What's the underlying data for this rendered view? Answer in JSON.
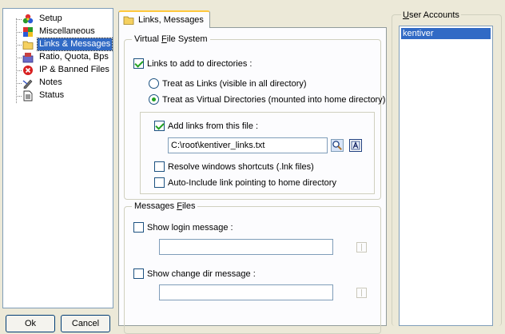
{
  "tree": {
    "items": [
      {
        "label": "Setup",
        "icon": "setup-icon"
      },
      {
        "label": "Miscellaneous",
        "icon": "miscellaneous-icon"
      },
      {
        "label": "Links & Messages",
        "icon": "folder-icon",
        "selected": true
      },
      {
        "label": "Ratio, Quota, Bps",
        "icon": "ratio-icon"
      },
      {
        "label": "IP & Banned Files",
        "icon": "banned-icon"
      },
      {
        "label": "Notes",
        "icon": "notes-icon"
      },
      {
        "label": "Status",
        "icon": "status-icon"
      }
    ]
  },
  "buttons": {
    "ok": "Ok",
    "cancel": "Cancel"
  },
  "tab": {
    "label": "Links, Messages"
  },
  "vfs": {
    "title_prefix": "Virtual ",
    "title_mnemonic": "F",
    "title_suffix": "ile System",
    "links_to_add": {
      "label": "Links to add to directories :",
      "checked": true
    },
    "treat_links": {
      "label": "Treat as Links (visible in all directory)",
      "checked": false
    },
    "treat_virtual": {
      "label": "Treat as Virtual Directories (mounted into home directory)",
      "checked": true
    },
    "add_links_file": {
      "label": "Add links from this file :",
      "checked": true
    },
    "file_path": "C:\\root\\kentiver_links.txt",
    "resolve_shortcuts": {
      "label": "Resolve windows shortcuts (.lnk files)",
      "checked": false
    },
    "auto_include": {
      "label": "Auto-Include link pointing to home directory",
      "checked": false
    }
  },
  "messages": {
    "title_prefix": "Messages ",
    "title_mnemonic": "F",
    "title_suffix": "iles",
    "show_login": {
      "label": "Show login message :",
      "checked": false,
      "value": ""
    },
    "show_change_dir": {
      "label": "Show change dir message :",
      "checked": false,
      "value": ""
    }
  },
  "user_accounts": {
    "title_mnemonic": "U",
    "title_suffix": "ser Accounts",
    "items": [
      "kentiver"
    ]
  },
  "colors": {
    "selection": "#316ac5",
    "background": "#ece9d8",
    "tab_highlight": "#ffc83c"
  }
}
